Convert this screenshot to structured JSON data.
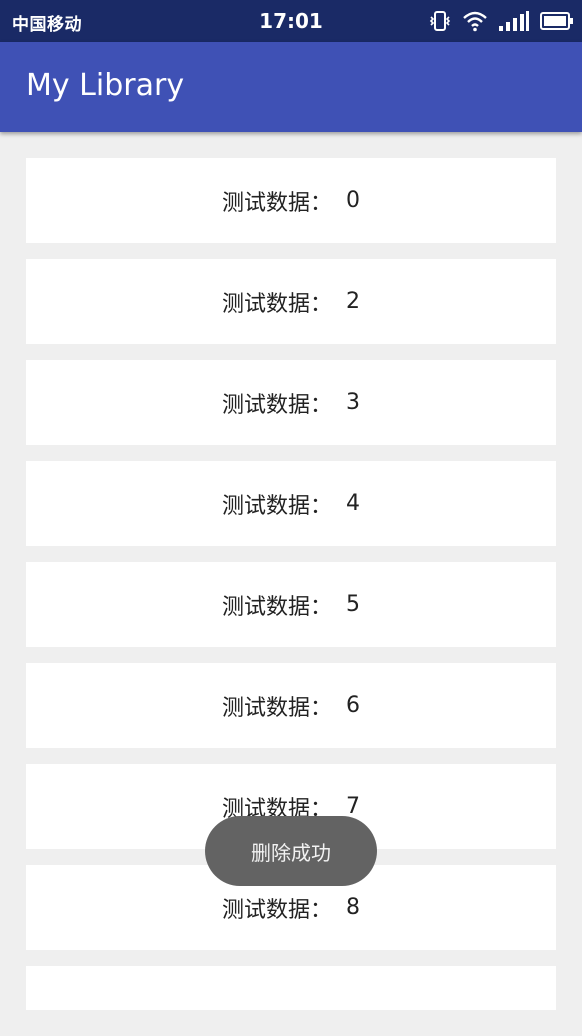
{
  "status_bar": {
    "carrier": "中国移动",
    "time": "17:01"
  },
  "app_bar": {
    "title": "My Library"
  },
  "list": {
    "items": [
      {
        "label": "测试数据：",
        "value": "0"
      },
      {
        "label": "测试数据：",
        "value": "2"
      },
      {
        "label": "测试数据：",
        "value": "3"
      },
      {
        "label": "测试数据：",
        "value": "4"
      },
      {
        "label": "测试数据：",
        "value": "5"
      },
      {
        "label": "测试数据：",
        "value": "6"
      },
      {
        "label": "测试数据：",
        "value": "7"
      },
      {
        "label": "测试数据：",
        "value": "8"
      },
      {
        "label": "",
        "value": ""
      }
    ]
  },
  "toast": {
    "message": "删除成功"
  },
  "colors": {
    "status_bar": "#1a2a66",
    "app_bar": "#3f51b5",
    "background": "#efefef",
    "card": "#ffffff",
    "toast": "#636363"
  },
  "icons": [
    "vibrate-icon",
    "wifi-icon",
    "signal-icon",
    "battery-icon"
  ]
}
